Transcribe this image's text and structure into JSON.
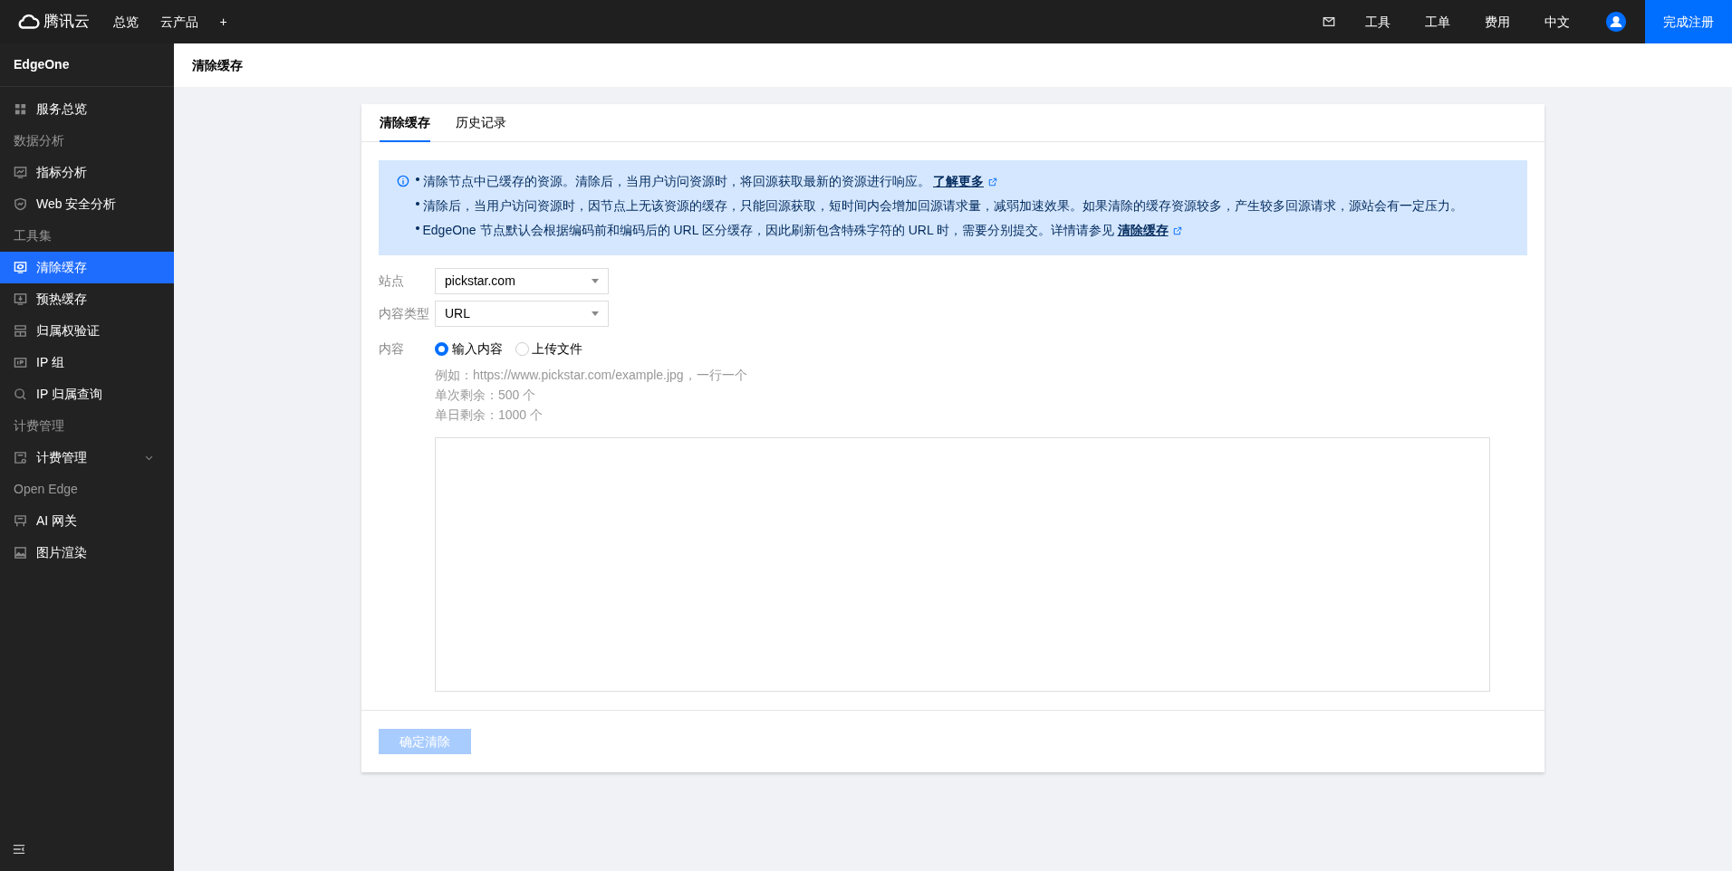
{
  "topbar": {
    "logo": "腾讯云",
    "nav": [
      "总览",
      "云产品",
      "+"
    ],
    "right": [
      "工具",
      "工单",
      "费用",
      "中文"
    ],
    "register": "完成注册"
  },
  "sidebar": {
    "title": "EdgeOne",
    "entries": [
      {
        "kind": "item",
        "label": "服务总览",
        "selected": false
      },
      {
        "kind": "heading",
        "label": "数据分析"
      },
      {
        "kind": "item",
        "label": "指标分析",
        "selected": false
      },
      {
        "kind": "item",
        "label": "Web 安全分析",
        "selected": false
      },
      {
        "kind": "heading",
        "label": "工具集"
      },
      {
        "kind": "item",
        "label": "清除缓存",
        "selected": true
      },
      {
        "kind": "item",
        "label": "预热缓存",
        "selected": false
      },
      {
        "kind": "item",
        "label": "归属权验证",
        "selected": false
      },
      {
        "kind": "item",
        "label": "IP 组",
        "selected": false
      },
      {
        "kind": "item",
        "label": "IP 归属查询",
        "selected": false
      },
      {
        "kind": "heading",
        "label": "计费管理"
      },
      {
        "kind": "group",
        "label": "计费管理",
        "selected": false,
        "expanded": false
      },
      {
        "kind": "heading",
        "label": "Open Edge"
      },
      {
        "kind": "item",
        "label": "AI 网关",
        "selected": false
      },
      {
        "kind": "item",
        "label": "图片渲染",
        "selected": false
      }
    ]
  },
  "page_title": "清除缓存",
  "tabs": [
    {
      "label": "清除缓存",
      "selected": true
    },
    {
      "label": "历史记录",
      "selected": false
    }
  ],
  "notice": [
    {
      "text": "清除节点中已缓存的资源。清除后，当用户访问资源时，将回源获取最新的资源进行响应。",
      "link": "了解更多"
    },
    {
      "text": "清除后，当用户访问资源时，因节点上无该资源的缓存，只能回源获取，短时间内会增加回源请求量，减弱加速效果。如果清除的缓存资源较多，产生较多回源请求，源站会有一定压力。"
    },
    {
      "text": "EdgeOne 节点默认会根据编码前和编码后的 URL 区分缓存，因此刷新包含特殊字符的 URL 时，需要分别提交。详情请参见",
      "link": "清除缓存"
    }
  ],
  "form": {
    "site": {
      "label": "站点",
      "value": "pickstar.com"
    },
    "content_type": {
      "label": "内容类型",
      "value": "URL"
    },
    "content": {
      "label": "内容",
      "options": [
        {
          "label": "输入内容",
          "selected": true
        },
        {
          "label": "上传文件",
          "selected": false
        }
      ],
      "hints": [
        "例如：https://www.pickstar.com/example.jpg，一行一个",
        "单次剩余：500 个",
        "单日剩余：1000 个"
      ]
    }
  },
  "submit": {
    "label": "确定清除",
    "disabled": true
  }
}
